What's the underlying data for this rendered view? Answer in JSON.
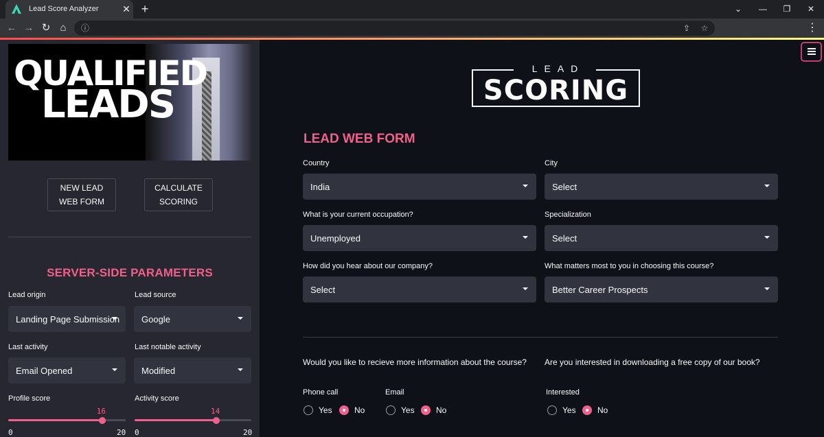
{
  "browser": {
    "tab_title": "Lead Score Analyzer",
    "tab_close": "✕",
    "new_tab": "+",
    "win_minimize": "—",
    "win_restore": "❐",
    "win_close": "✕",
    "chevron": "⌄",
    "back": "←",
    "forward": "→",
    "reload": "↻",
    "home": "⌂",
    "info": "ⓘ",
    "share": "⇪",
    "star": "☆",
    "menu": "⋮"
  },
  "sidebar": {
    "hero_line1": "QUALIFIED",
    "hero_line2": "LEADS",
    "new_lead_button": "NEW LEAD WEB FORM",
    "calculate_button": "CALCULATE SCORING",
    "heading": "SERVER-SIDE PARAMETERS",
    "lead_origin": {
      "label": "Lead origin",
      "value": "Landing Page Submission"
    },
    "lead_source": {
      "label": "Lead source",
      "value": "Google"
    },
    "last_activity": {
      "label": "Last activity",
      "value": "Email Opened"
    },
    "last_notable_activity": {
      "label": "Last notable activity",
      "value": "Modified"
    },
    "profile_score": {
      "label": "Profile score",
      "value": 16,
      "min": 0,
      "max": 20
    },
    "activity_score": {
      "label": "Activity score",
      "value": 14,
      "min": 0,
      "max": 20
    }
  },
  "main": {
    "logo_top": "LEAD",
    "logo_main": "SCORING",
    "heading": "LEAD WEB FORM",
    "country": {
      "label": "Country",
      "value": "India"
    },
    "city": {
      "label": "City",
      "value": "Select"
    },
    "occupation": {
      "label": "What is your current occupation?",
      "value": "Unemployed"
    },
    "specialization": {
      "label": "Specialization",
      "value": "Select"
    },
    "hear_about": {
      "label": "How did you hear about our company?",
      "value": "Select"
    },
    "matters_most": {
      "label": "What matters most to you in choosing this course?",
      "value": "Better Career Prospects"
    },
    "more_info_question": "Would you like to recieve more information about the course?",
    "book_question": "Are you interested in downloading a free copy of our book?",
    "phone_call": {
      "label": "Phone call",
      "yes": "Yes",
      "no": "No",
      "selected": "No"
    },
    "email": {
      "label": "Email",
      "yes": "Yes",
      "no": "No",
      "selected": "No"
    },
    "interested": {
      "label": "Interested",
      "yes": "Yes",
      "no": "No",
      "selected": "No"
    }
  },
  "colors": {
    "accent": "#f1608a",
    "sidebar_bg": "#262730",
    "main_bg": "#0e1117",
    "select_bg": "#31333f"
  }
}
